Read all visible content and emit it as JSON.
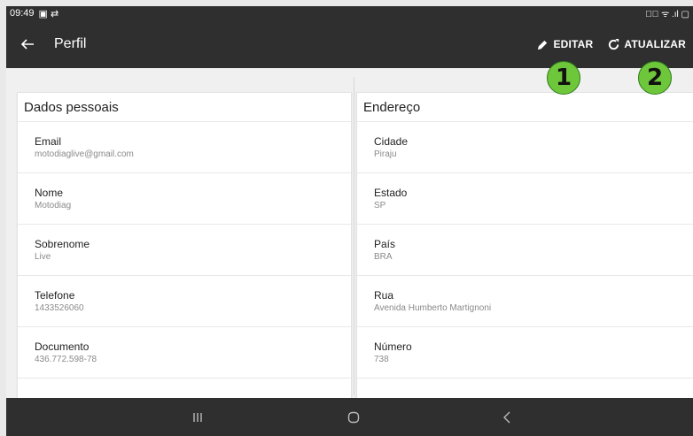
{
  "statusbar": {
    "time": "09:49",
    "left_icons": "▣ ⇄",
    "right_icons": "✕⃝ ᯤ .ıl ▢"
  },
  "appbar": {
    "title": "Perfil",
    "edit_label": "EDITAR",
    "refresh_label": "ATUALIZAR"
  },
  "badges": {
    "one": "1",
    "two": "2"
  },
  "personal": {
    "heading": "Dados pessoais",
    "rows": [
      {
        "label": "Email",
        "value": "motodiaglive@gmail.com"
      },
      {
        "label": "Nome",
        "value": "Motodiag"
      },
      {
        "label": "Sobrenome",
        "value": "Live"
      },
      {
        "label": "Telefone",
        "value": "1433526060"
      },
      {
        "label": "Documento",
        "value": "436.772.598-78"
      }
    ]
  },
  "address": {
    "heading": "Endereço",
    "rows": [
      {
        "label": "Cidade",
        "value": "Piraju"
      },
      {
        "label": "Estado",
        "value": "SP"
      },
      {
        "label": "País",
        "value": "BRA"
      },
      {
        "label": "Rua",
        "value": "Avenida Humberto Martignoni"
      },
      {
        "label": "Número",
        "value": "738"
      }
    ]
  },
  "colors": {
    "bar": "#2f2f2f",
    "badge": "#6ec63a"
  },
  "icons": [
    "back-arrow-icon",
    "pencil-icon",
    "refresh-icon",
    "recents-icon",
    "home-icon",
    "back-nav-icon"
  ]
}
